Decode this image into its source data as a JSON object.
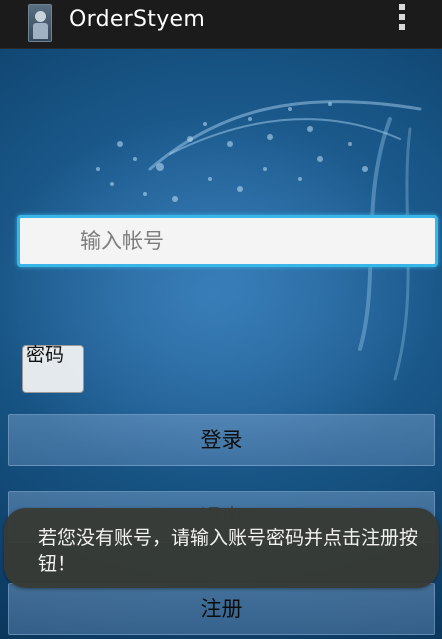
{
  "action_bar": {
    "title": "OrderStyem",
    "icon": "app-avatar-icon",
    "menu_icon": "overflow-menu-icon",
    "background": "#1b1b1b"
  },
  "form": {
    "account_placeholder": "输入帐号",
    "password_label": "密码",
    "focus_color": "#38b6e8"
  },
  "buttons": {
    "login": "登录",
    "exit": "退出",
    "register": "注册"
  },
  "toast": {
    "message": "若您没有账号，请输入账号密码并点击注册按钮！"
  }
}
